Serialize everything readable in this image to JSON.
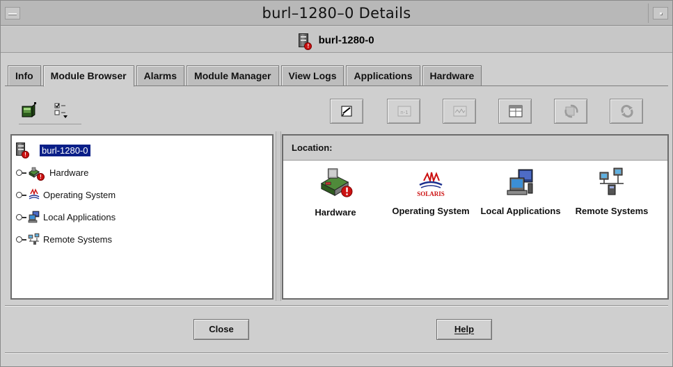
{
  "window": {
    "title": "burl–1280–0 Details"
  },
  "header": {
    "host": "burl-1280-0",
    "host_icon": "server-alert-icon"
  },
  "tabs": [
    {
      "label": "Info",
      "active": false
    },
    {
      "label": "Module Browser",
      "active": true
    },
    {
      "label": "Alarms",
      "active": false
    },
    {
      "label": "Module Manager",
      "active": false
    },
    {
      "label": "View Logs",
      "active": false
    },
    {
      "label": "Applications",
      "active": false
    },
    {
      "label": "Hardware",
      "active": false
    }
  ],
  "toolbar": {
    "left_icons": [
      "module-tree-icon",
      "checklist-menu-icon"
    ],
    "buttons": [
      {
        "icon": "edit-icon",
        "enabled": true
      },
      {
        "icon": "graph-n1-icon",
        "enabled": false
      },
      {
        "icon": "graph-wave-icon",
        "enabled": false
      },
      {
        "icon": "table-view-icon",
        "enabled": true
      },
      {
        "icon": "refresh-arrows-icon",
        "enabled": false
      },
      {
        "icon": "reload-icon",
        "enabled": false
      }
    ]
  },
  "tree": {
    "root": "burl-1280-0",
    "items": [
      {
        "label": "Hardware",
        "icon": "hardware-icon",
        "alert": true
      },
      {
        "label": "Operating System",
        "icon": "solaris-icon",
        "alert": false
      },
      {
        "label": "Local Applications",
        "icon": "local-applications-icon",
        "alert": false
      },
      {
        "label": "Remote Systems",
        "icon": "remote-systems-icon",
        "alert": false
      }
    ]
  },
  "location": {
    "label": "Location:",
    "items": [
      {
        "label": "Hardware",
        "icon": "hardware-icon",
        "alert": true
      },
      {
        "label": "Operating System",
        "icon": "solaris-icon",
        "brand": "SOLARIS"
      },
      {
        "label": "Local Applications",
        "icon": "local-applications-icon"
      },
      {
        "label": "Remote Systems",
        "icon": "remote-systems-icon"
      }
    ]
  },
  "buttons": {
    "close": "Close",
    "help": "Help"
  },
  "colors": {
    "selection": "#0a1f88",
    "alert": "#cc1111",
    "window_bg": "#cfcfcf",
    "solaris_red": "#cc1010",
    "solaris_blue": "#1b2f8e"
  }
}
